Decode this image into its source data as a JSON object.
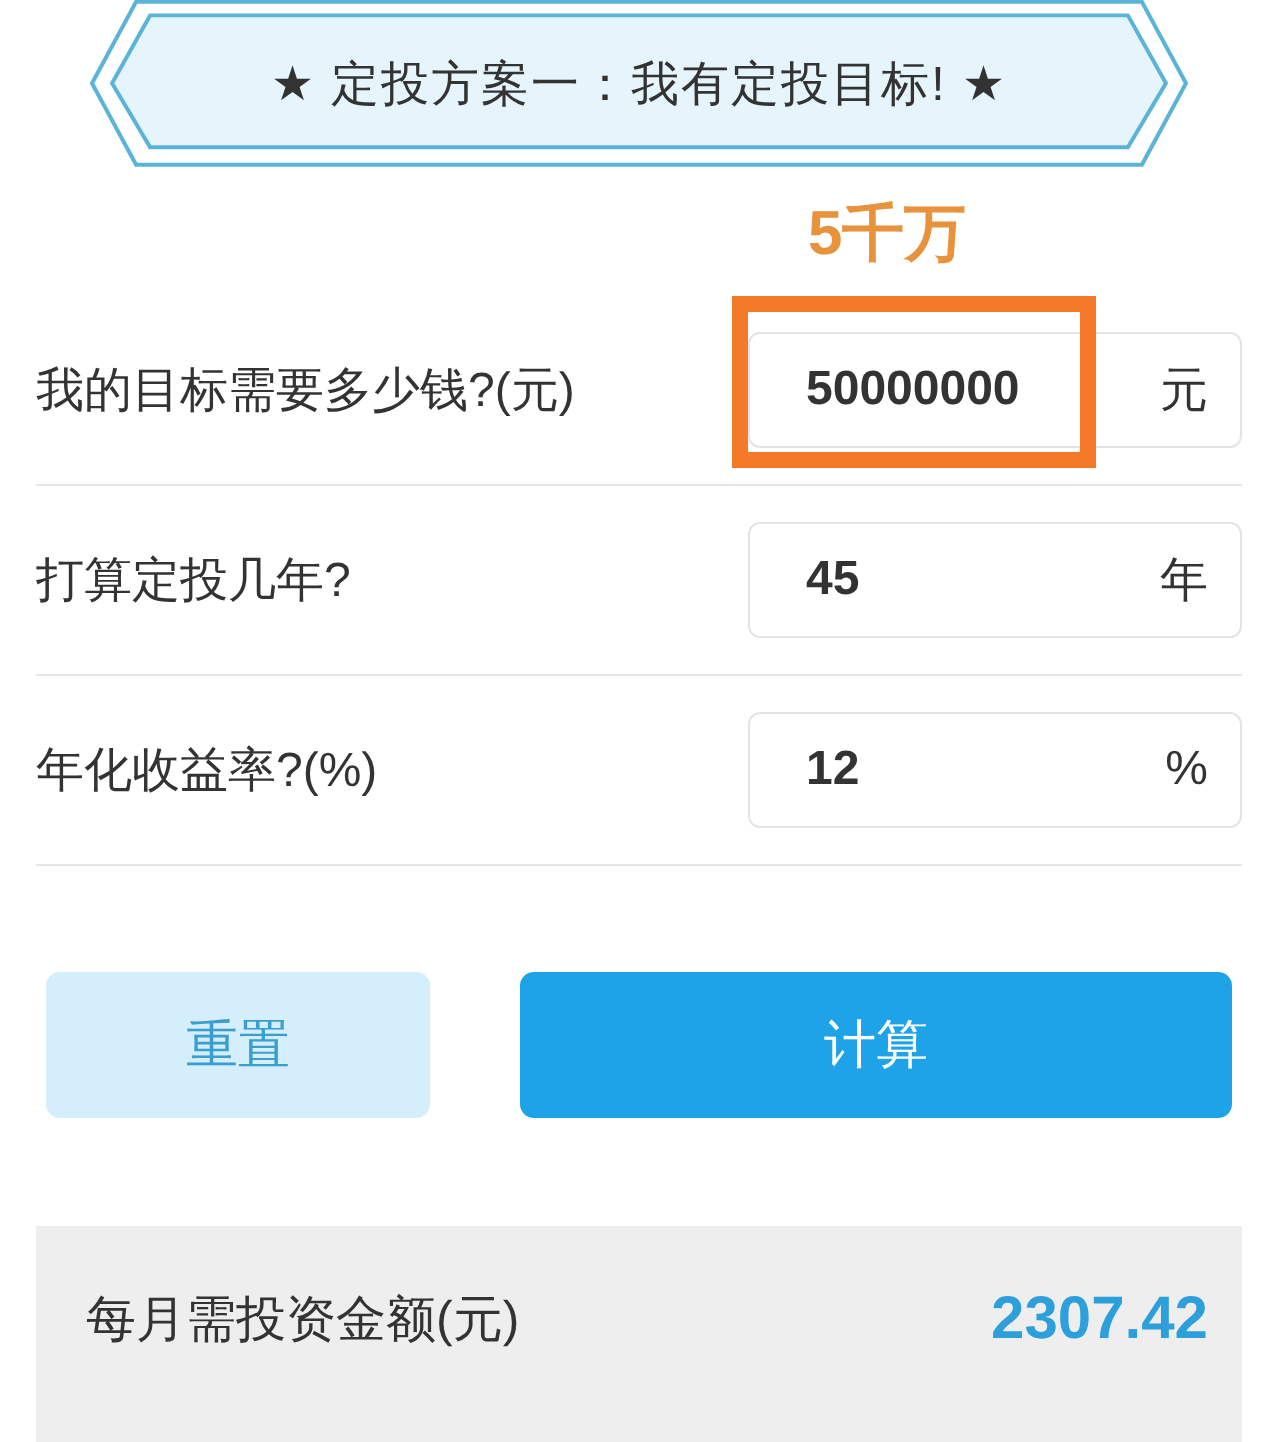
{
  "banner": {
    "title": "★ 定投方案一：我有定投目标! ★"
  },
  "annotation": {
    "label": "5千万"
  },
  "fields": [
    {
      "label": "我的目标需要多少钱?(元)",
      "value": "50000000",
      "unit": "元",
      "highlighted": true
    },
    {
      "label": "打算定投几年?",
      "value": "45",
      "unit": "年",
      "highlighted": false
    },
    {
      "label": "年化收益率?(%)",
      "value": "12",
      "unit": "%",
      "highlighted": false
    }
  ],
  "buttons": [
    {
      "label": "重置",
      "kind": "secondary"
    },
    {
      "label": "计算",
      "kind": "primary"
    }
  ],
  "result": {
    "label": "每月需投资金额(元)",
    "value": "2307.42"
  }
}
